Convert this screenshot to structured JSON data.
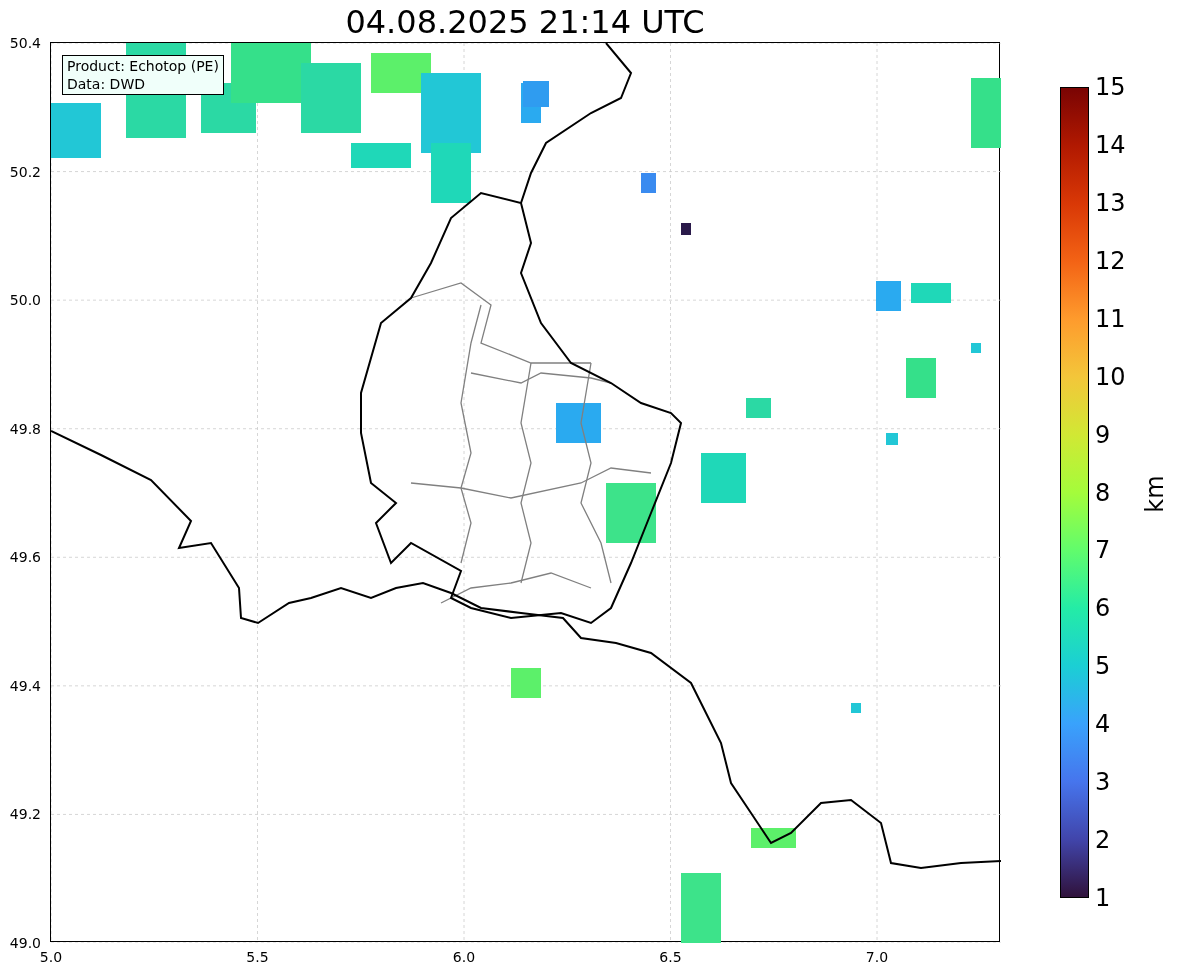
{
  "title": "04.08.2025 21:14 UTC",
  "info_box": {
    "lines": [
      "Product: Echotop (PE)",
      "Data: DWD"
    ]
  },
  "x_ticks": [
    "5.0",
    "5.5",
    "6.0",
    "6.5",
    "7.0"
  ],
  "y_ticks": [
    "50.4",
    "50.2",
    "50.0",
    "49.8",
    "49.6",
    "49.4",
    "49.2",
    "49.0"
  ],
  "colorbar": {
    "label": "km",
    "ticks": [
      "15",
      "14",
      "13",
      "12",
      "11",
      "10",
      "9",
      "8",
      "7",
      "6",
      "5",
      "4",
      "3",
      "2",
      "1"
    ]
  }
}
